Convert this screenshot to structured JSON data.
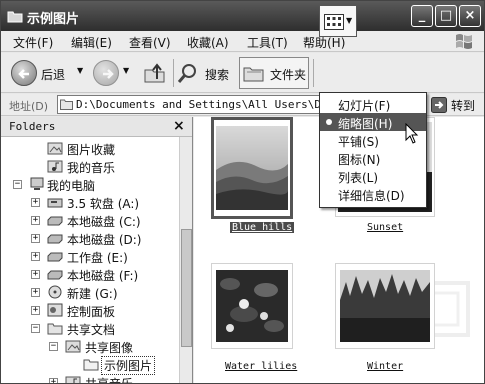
{
  "window": {
    "title": "示例图片"
  },
  "menu": {
    "items": [
      "文件(F)",
      "编辑(E)",
      "查看(V)",
      "收藏(A)",
      "工具(T)",
      "帮助(H)"
    ]
  },
  "toolbar": {
    "back_label": "后退",
    "search_label": "搜索",
    "folders_label": "文件夹"
  },
  "address": {
    "label": "地址(D)",
    "value": "D:\\Documents and Settings\\All Users\\Documents\\My Pictures\\示例图片",
    "go_label": "转到"
  },
  "folders_pane": {
    "title": "Folders",
    "close_glyph": "×",
    "items": [
      {
        "label": "图片收藏"
      },
      {
        "label": "我的音乐"
      },
      {
        "label": "我的电脑",
        "expander": "−"
      },
      {
        "label": "3.5 软盘 (A:)",
        "expander": "+"
      },
      {
        "label": "本地磁盘 (C:)",
        "expander": "+"
      },
      {
        "label": "本地磁盘 (D:)",
        "expander": "+"
      },
      {
        "label": "工作盘 (E:)",
        "expander": "+"
      },
      {
        "label": "本地磁盘 (F:)",
        "expander": "+"
      },
      {
        "label": "新建 (G:)",
        "expander": "+"
      },
      {
        "label": "控制面板",
        "expander": "+"
      },
      {
        "label": "共享文档",
        "expander": "−"
      },
      {
        "label": "共享图像",
        "expander": "−"
      },
      {
        "label": "示例图片"
      },
      {
        "label": "共享音乐",
        "expander": "+"
      }
    ]
  },
  "thumbnails": [
    {
      "caption": "Blue hills",
      "selected": true
    },
    {
      "caption": "Sunset",
      "selected": false
    },
    {
      "caption": "Water lilies",
      "selected": false
    },
    {
      "caption": "Winter",
      "selected": false
    }
  ],
  "views_menu": {
    "items": [
      {
        "label": "幻灯片(F)",
        "selected": false
      },
      {
        "label": "缩略图(H)",
        "selected": true
      },
      {
        "label": "平铺(S)",
        "selected": false
      },
      {
        "label": "图标(N)",
        "selected": false
      },
      {
        "label": "列表(L)",
        "selected": false
      },
      {
        "label": "详细信息(D)",
        "selected": false
      }
    ]
  },
  "icons": {
    "title": "folder-icon",
    "back": "back-arrow-icon",
    "forward": "forward-arrow-icon",
    "up": "up-folder-icon",
    "search": "magnifier-icon",
    "folders": "folders-icon",
    "views": "views-grid-icon",
    "go": "go-arrow-icon",
    "windows_logo": "windows-flag-icon"
  }
}
